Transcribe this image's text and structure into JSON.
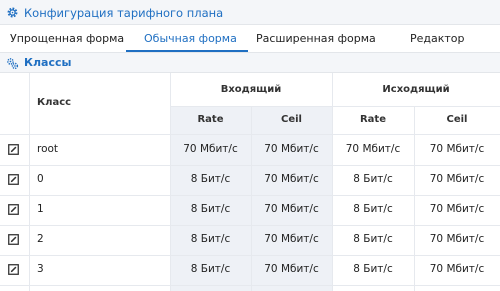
{
  "header": {
    "title": "Конфигурация тарифного плана",
    "icon": "settings-icon",
    "accent": "#1f6fc2"
  },
  "tabs": [
    {
      "label": "Упрощенная форма",
      "active": false
    },
    {
      "label": "Обычная форма",
      "active": true
    },
    {
      "label": "Расширенная форма",
      "active": false
    },
    {
      "label": "Редактор",
      "active": false
    }
  ],
  "section": {
    "title": "Классы",
    "icon": "classes-icon"
  },
  "table": {
    "class_header": "Класс",
    "incoming_header": "Входящий",
    "outgoing_header": "Исходящий",
    "rate_label": "Rate",
    "ceil_label": "Ceil",
    "rows": [
      {
        "name": "root",
        "in_rate": "70 Мбит/с",
        "in_ceil": "70 Мбит/с",
        "out_rate": "70 Мбит/с",
        "out_ceil": "70 Мбит/с"
      },
      {
        "name": "0",
        "in_rate": "8 Бит/с",
        "in_ceil": "70 Мбит/с",
        "out_rate": "8 Бит/с",
        "out_ceil": "70 Мбит/с"
      },
      {
        "name": "1",
        "in_rate": "8 Бит/с",
        "in_ceil": "70 Мбит/с",
        "out_rate": "8 Бит/с",
        "out_ceil": "70 Мбит/с"
      },
      {
        "name": "2",
        "in_rate": "8 Бит/с",
        "in_ceil": "70 Мбит/с",
        "out_rate": "8 Бит/с",
        "out_ceil": "70 Мбит/с"
      },
      {
        "name": "3",
        "in_rate": "8 Бит/с",
        "in_ceil": "70 Мбит/с",
        "out_rate": "8 Бит/с",
        "out_ceil": "70 Мбит/с"
      }
    ]
  }
}
